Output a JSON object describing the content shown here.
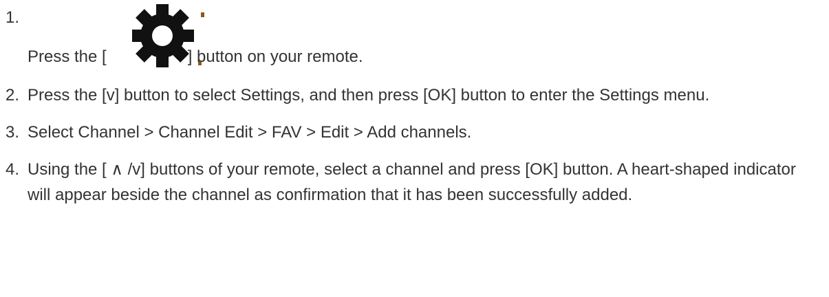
{
  "steps": [
    {
      "number": "1.",
      "before": "Press the [",
      "icon": "gear-icon",
      "after": "] button on your remote."
    },
    {
      "number": "2.",
      "text": "Press the [v] button to select Settings, and then press [OK] button to enter the Settings menu."
    },
    {
      "number": "3.",
      "text": "Select Channel > Channel Edit > FAV > Edit > Add channels."
    },
    {
      "number": "4.",
      "text": "Using the [ ∧ /v] buttons of your remote, select a channel and press [OK] button. A heart-shaped indicator will appear beside the channel as confirmation that it has been successfully added."
    }
  ],
  "colors": {
    "text": "#333333",
    "icon": "#111111",
    "icon_dot": "#8b5a1a"
  }
}
